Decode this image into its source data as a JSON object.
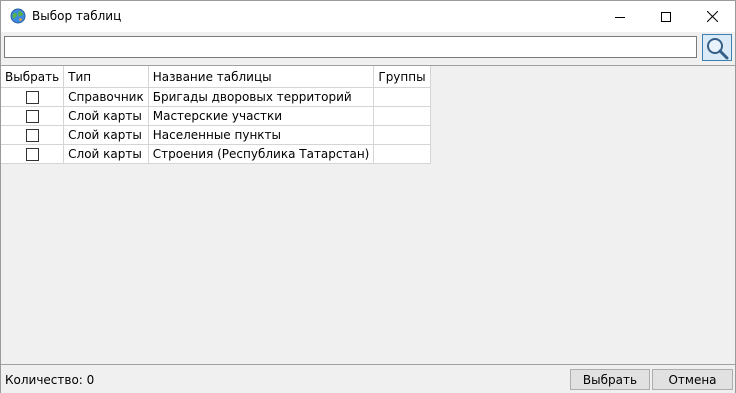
{
  "window": {
    "title": "Выбор таблиц",
    "icon": "globe-icon"
  },
  "search": {
    "value": "",
    "placeholder": "",
    "button_icon": "magnifier-icon"
  },
  "table": {
    "columns": [
      "Выбрать",
      "Тип",
      "Название таблицы",
      "Группы"
    ],
    "rows": [
      {
        "checked": false,
        "type": "Справочник",
        "name": "Бригады дворовых территорий",
        "groups": ""
      },
      {
        "checked": false,
        "type": "Слой карты",
        "name": "Мастерские участки",
        "groups": ""
      },
      {
        "checked": false,
        "type": "Слой карты",
        "name": "Населенные пункты",
        "groups": ""
      },
      {
        "checked": false,
        "type": "Слой карты",
        "name": "Строения (Республика Татарстан)",
        "groups": ""
      }
    ]
  },
  "status": {
    "count_text": "Количество: 0"
  },
  "buttons": {
    "select": "Выбрать",
    "cancel": "Отмена"
  }
}
